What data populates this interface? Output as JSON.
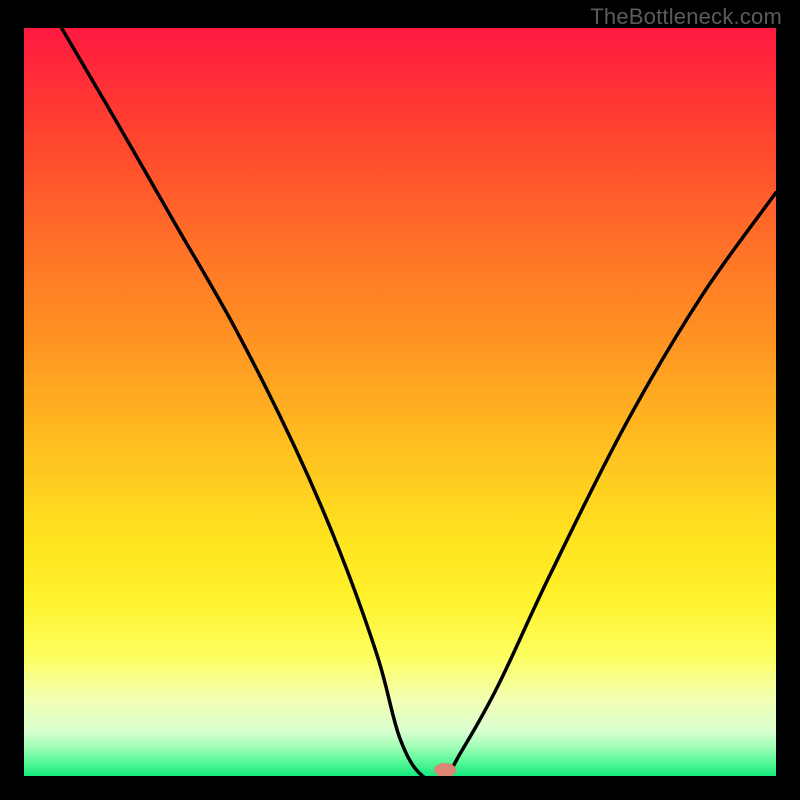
{
  "watermark": "TheBottleneck.com",
  "chart_data": {
    "type": "line",
    "title": "",
    "xlabel": "",
    "ylabel": "",
    "xlim": [
      0,
      100
    ],
    "ylim": [
      0,
      100
    ],
    "series": [
      {
        "name": "bottleneck-curve",
        "x": [
          5,
          12,
          20,
          28,
          36,
          42,
          47,
          50,
          53,
          56,
          58,
          63,
          70,
          80,
          90,
          100
        ],
        "values": [
          100,
          88,
          74,
          60,
          44,
          30,
          16,
          5,
          0,
          0,
          3,
          12,
          27,
          47,
          64,
          78
        ]
      }
    ],
    "marker": {
      "x": 56,
      "y": 0,
      "color": "#d98773"
    },
    "background_gradient": [
      "#ff1940",
      "#ffe31f",
      "#17e87c"
    ]
  }
}
